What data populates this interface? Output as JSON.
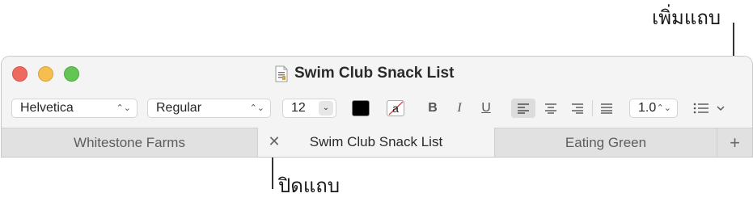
{
  "callouts": {
    "add_tab": "เพิ่มแถบ",
    "close_tab": "ปิดแถบ"
  },
  "window": {
    "title": "Swim Club Snack List"
  },
  "toolbar": {
    "font_family": "Helvetica",
    "font_style": "Regular",
    "font_size": "12",
    "bold": "B",
    "italic": "I",
    "underline": "U",
    "line_spacing": "1.0",
    "text_color": "#000000",
    "highlight_letter": "a"
  },
  "tabs": [
    {
      "label": "Whitestone Farms"
    },
    {
      "label": "Swim Club Snack List",
      "active": true
    },
    {
      "label": "Eating Green"
    }
  ],
  "icons": {
    "close": "close-icon",
    "add": "plus-icon"
  }
}
